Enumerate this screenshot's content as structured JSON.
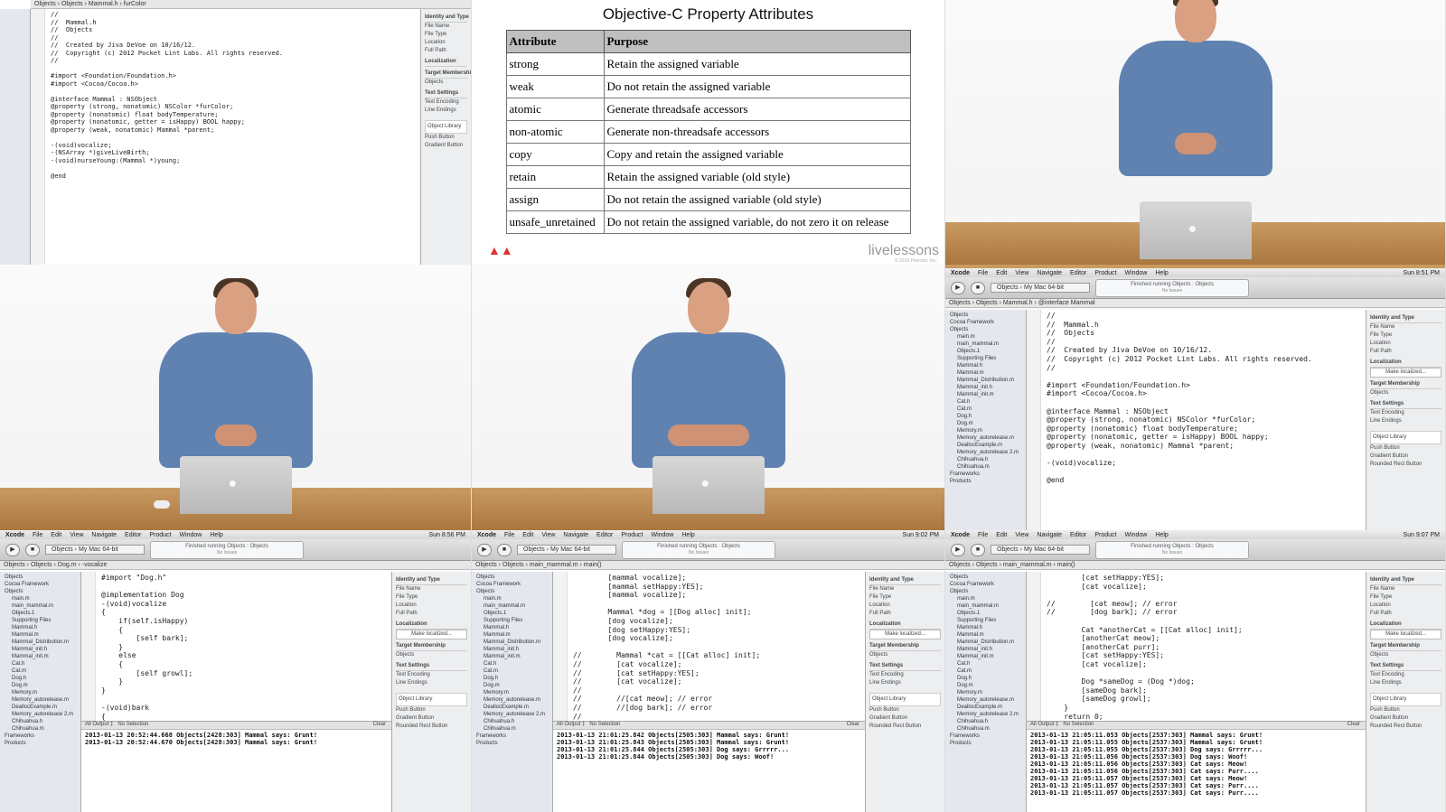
{
  "xcode": {
    "menu": [
      "Xcode",
      "File",
      "Edit",
      "View",
      "Navigate",
      "Editor",
      "Product",
      "Window",
      "Help"
    ],
    "scheme": "Objects › My Mac 64-bit",
    "activity": "Finished running Objects : Objects",
    "activity_sub": "No Issues",
    "nav_items": [
      "Objects",
      "Cocoa Framework",
      "Objects",
      "main.m",
      "main_mammal.m",
      "Objects.1",
      "Supporting Files",
      "Mammal.h",
      "Mammal.m",
      "Mammal_Distribution.m",
      "Mammal_init.h",
      "Mammal_init.m",
      "Cat.h",
      "Cat.m",
      "Dog.h",
      "Dog.m",
      "Memory.m",
      "Memory_autorelease.m",
      "DeallocExample.m",
      "Memory_autorelease 2.m",
      "Chihuahua.h",
      "Chihuahua.m",
      "Frameworks",
      "Products"
    ],
    "inspector": {
      "identity": "Identity and Type",
      "file_name": "File Name",
      "file_type": "File Type",
      "location": "Location",
      "full_path": "Full Path",
      "localization": "Localization",
      "make_localized": "Make localized...",
      "target": "Target Membership",
      "target_item": "Objects",
      "text_settings": "Text Settings",
      "text_encoding": "Text Encoding",
      "line_endings": "Line Endings",
      "object_library": "Object Library",
      "push_button": "Push Button",
      "gradient_button": "Gradient Button",
      "rounded_button": "Rounded Rect Button"
    },
    "all_output": "All Output ‡",
    "no_selection": "No Selection",
    "clear": "Clear"
  },
  "panel1": {
    "breadcrumb": "Objects › Objects › Mammal.h › furColor",
    "code": "//\n//  Mammal.h\n//  Objects\n//\n//  Created by Jiva DeVoe on 10/16/12.\n//  Copyright (c) 2012 Pocket Lint Labs. All rights reserved.\n//\n\n#import <Foundation/Foundation.h>\n#import <Cocoa/Cocoa.h>\n\n@interface Mammal : NSObject\n@property (strong, nonatomic) NSColor *furColor;\n@property (nonatomic) float bodyTemperature;\n@property (nonatomic, getter = isHappy) BOOL happy;\n@property (weak, nonatomic) Mammal *parent;\n\n-(void)vocalize;\n-(NSArray *)giveLiveBirth;\n-(void)nurseYoung:(Mammal *)young;\n\n@end"
  },
  "slide": {
    "title": "Objective-C Property Attributes",
    "headers": [
      "Attribute",
      "Purpose"
    ],
    "rows": [
      [
        "strong",
        "Retain the assigned variable"
      ],
      [
        "weak",
        "Do not retain the assigned variable"
      ],
      [
        "atomic",
        "Generate threadsafe accessors"
      ],
      [
        "non-atomic",
        "Generate non-threadsafe accessors"
      ],
      [
        "copy",
        "Copy and retain the assigned variable"
      ],
      [
        "retain",
        "Retain the assigned variable (old style)"
      ],
      [
        "assign",
        "Do not retain the assigned variable (old style)"
      ],
      [
        "unsafe_unretained",
        "Do not retain the assigned variable, do not zero it on release"
      ]
    ],
    "brand": "livelessons",
    "brand_sub": "© 2013 Pearson, Inc."
  },
  "panel6": {
    "clock": "Sun 8:51 PM",
    "title": "Objects.xcodeproj — Mammal.h",
    "breadcrumb": "Objects › Objects › Mammal.h › @interface Mammal",
    "code": "//\n//  Mammal.h\n//  Objects\n//\n//  Created by Jiva DeVoe on 10/16/12.\n//  Copyright (c) 2012 Pocket Lint Labs. All rights reserved.\n//\n\n#import <Foundation/Foundation.h>\n#import <Cocoa/Cocoa.h>\n\n@interface Mammal : NSObject\n@property (strong, nonatomic) NSColor *furColor;\n@property (nonatomic) float bodyTemperature;\n@property (nonatomic, getter = isHappy) BOOL happy;\n@property (weak, nonatomic) Mammal *parent;\n\n-(void)vocalize;\n\n@end"
  },
  "panel7": {
    "clock": "Sun 8:56 PM",
    "title": "Objects.xcodeproj — Dog.m",
    "breadcrumb": "Objects › Objects › Dog.m › -vocalize",
    "code": "#import \"Dog.h\"\n\n@implementation Dog\n-(void)vocalize\n{\n    if(self.isHappy)\n    {\n        [self bark];\n    }\n    else\n    {\n        [self growl];\n    }\n}\n\n-(void)bark\n{",
    "console": "2013-01-13 20:52:44.668 Objects[2428:303] Mammal says: Grunt!\n2013-01-13 20:52:44.670 Objects[2428:303] Mammal says: Grunt!"
  },
  "panel8": {
    "clock": "Sun 9:02 PM",
    "title": "Objects.xcodeproj — main_mammal.m",
    "breadcrumb": "Objects › Objects › main_mammal.m › main()",
    "code": "        [mammal vocalize];\n        [mammal setHappy:YES];\n        [mammal vocalize];\n\n        Mammal *dog = [[Dog alloc] init];\n        [dog vocalize];\n        [dog setHappy:YES];\n        [dog vocalize];\n\n//        Mammal *cat = [[Cat alloc] init];\n//        [cat vocalize];\n//        [cat setHappy:YES];\n//        [cat vocalize];\n//\n//        //[cat meow]; // error\n//        //[dog bark]; // error\n//",
    "console": "2013-01-13 21:01:25.842 Objects[2505:303] Mammal says: Grunt!\n2013-01-13 21:01:25.843 Objects[2505:303] Mammal says: Grunt!\n2013-01-13 21:01:25.844 Objects[2505:303] Dog says: Grrrrr...\n2013-01-13 21:01:25.844 Objects[2505:303] Dog says: Woof!"
  },
  "panel9": {
    "clock": "Sun 9:07 PM",
    "title": "Objects.xcodeproj — main_mammal.m",
    "breadcrumb": "Objects › Objects › main_mammal.m › main()",
    "code": "        [cat setHappy:YES];\n        [cat vocalize];\n\n//        [cat meow]; // error\n//        [dog bark]; // error\n\n        Cat *anotherCat = [[Cat alloc] init];\n        [anotherCat meow];\n        [anotherCat purr];\n        [cat setHappy:YES];\n        [cat vocalize];\n\n        Dog *sameDog = (Dog *)dog;\n        [sameDog bark];\n        [sameDog growl];\n    }\n    return 0;",
    "console": "2013-01-13 21:05:11.053 Objects[2537:303] Mammal says: Grunt!\n2013-01-13 21:05:11.055 Objects[2537:303] Mammal says: Grunt!\n2013-01-13 21:05:11.055 Objects[2537:303] Dog says: Grrrrr...\n2013-01-13 21:05:11.056 Objects[2537:303] Dog says: Woof!\n2013-01-13 21:05:11.056 Objects[2537:303] Cat says: Meow!\n2013-01-13 21:05:11.056 Objects[2537:303] Cat says: Purr....\n2013-01-13 21:05:11.057 Objects[2537:303] Cat says: Meow!\n2013-01-13 21:05:11.057 Objects[2537:303] Cat says: Purr....\n2013-01-13 21:05:11.057 Objects[2537:303] Cat says: Purr...."
  }
}
